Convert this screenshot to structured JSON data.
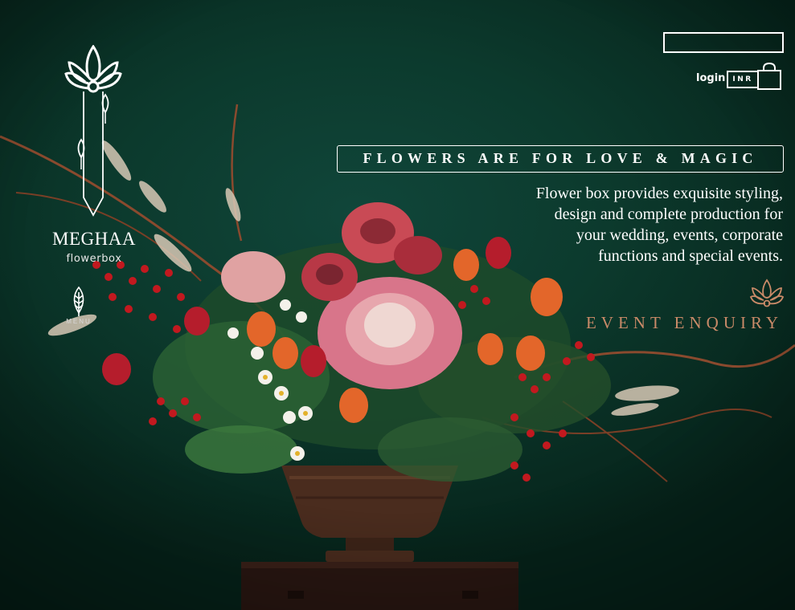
{
  "brand": {
    "name": "MEGHAA",
    "subname": "flowerbox"
  },
  "menu": {
    "label": "MENU"
  },
  "header": {
    "search_placeholder": "",
    "search_value": "",
    "login_label": "login",
    "currency": "INR"
  },
  "hero": {
    "tagline": "FLOWERS ARE FOR LOVE & MAGIC",
    "description_lines": [
      "Flower box provides exquisite styling,",
      "design and complete production for",
      "your wedding, events, corporate",
      "functions and special events."
    ],
    "enquiry_label": "EVENT ENQUIRY"
  },
  "colors": {
    "background": "#0d3a2c",
    "accent": "#c98a68",
    "text": "#ffffff"
  },
  "icons": [
    "lotus-logo-icon",
    "leaf-menu-icon",
    "search-icon",
    "shopping-bag-icon",
    "lotus-enquiry-icon"
  ]
}
